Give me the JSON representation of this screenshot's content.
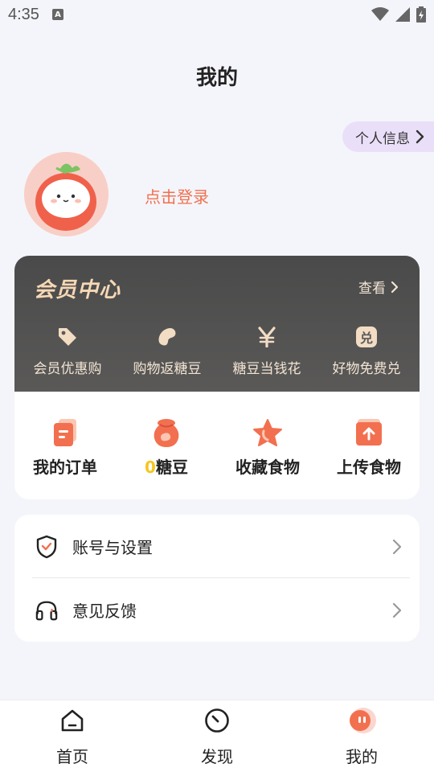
{
  "status_bar": {
    "time": "4:35",
    "notification_icon": "A"
  },
  "header": {
    "title": "我的"
  },
  "profile": {
    "info_pill_label": "个人信息",
    "login_label": "点击登录"
  },
  "vip": {
    "title": "会员中心",
    "view_label": "查看",
    "perks": [
      {
        "label": "会员优惠购",
        "icon": "tag-icon"
      },
      {
        "label": "购物返糖豆",
        "icon": "bean-icon"
      },
      {
        "label": "糖豆当钱花",
        "icon": "yen-icon"
      },
      {
        "label": "好物免费兑",
        "icon": "exchange-icon",
        "badge": "兑"
      }
    ]
  },
  "actions": [
    {
      "label": "我的订单",
      "icon": "order-icon"
    },
    {
      "count": "0",
      "label": "糖豆",
      "icon": "bean-bag-icon"
    },
    {
      "label": "收藏食物",
      "icon": "star-icon"
    },
    {
      "label": "上传食物",
      "icon": "upload-icon"
    }
  ],
  "settings": [
    {
      "label": "账号与设置",
      "icon": "shield-icon"
    },
    {
      "label": "意见反馈",
      "icon": "headset-icon"
    }
  ],
  "bottom_nav": [
    {
      "label": "首页",
      "icon": "home-icon"
    },
    {
      "label": "发现",
      "icon": "compass-icon"
    },
    {
      "label": "我的",
      "icon": "mascot-icon",
      "active": true
    }
  ],
  "colors": {
    "accent": "#F2704F",
    "vip_gold": "#F6D8B5",
    "bean_yellow": "#F7C51E",
    "page_bg": "#F4F5FA"
  }
}
